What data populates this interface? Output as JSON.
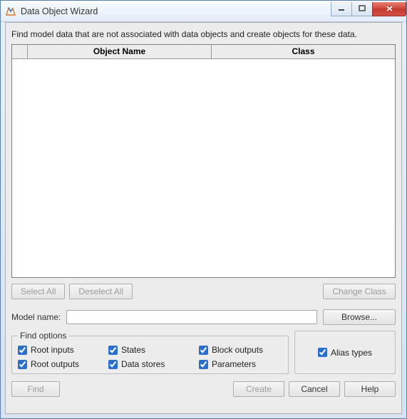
{
  "window": {
    "title": "Data Object Wizard"
  },
  "desc": "Find model data that are not associated with data objects and create objects for these data.",
  "table": {
    "headers": {
      "name": "Object Name",
      "class": "Class"
    },
    "rows": []
  },
  "buttons": {
    "select_all": "Select All",
    "deselect_all": "Deselect All",
    "change_class": "Change Class",
    "find": "Find",
    "create": "Create",
    "cancel": "Cancel",
    "help": "Help",
    "browse": "Browse..."
  },
  "model": {
    "label": "Model name:",
    "value": ""
  },
  "find_options": {
    "legend": "Find options",
    "root_inputs": {
      "label": "Root inputs",
      "checked": true
    },
    "states": {
      "label": "States",
      "checked": true
    },
    "block_outputs": {
      "label": "Block outputs",
      "checked": true
    },
    "root_outputs": {
      "label": "Root outputs",
      "checked": true
    },
    "data_stores": {
      "label": "Data stores",
      "checked": true
    },
    "parameters": {
      "label": "Parameters",
      "checked": true
    },
    "alias_types": {
      "label": "Alias types",
      "checked": true
    }
  }
}
